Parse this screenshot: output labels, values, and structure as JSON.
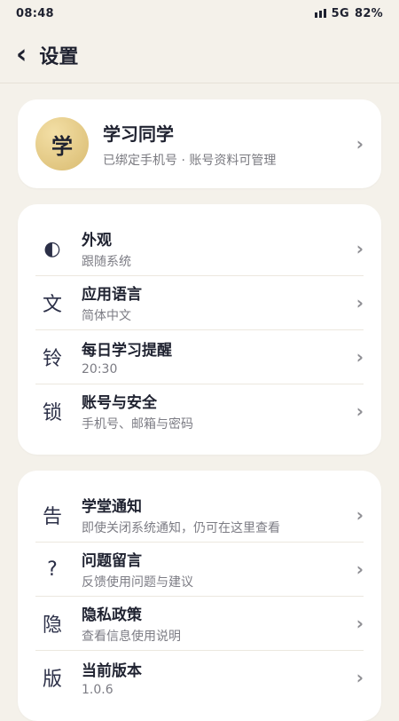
{
  "status": {
    "time": "08:48",
    "network": "5G",
    "battery": "82%"
  },
  "header": {
    "back_icon": "‹",
    "title": "设置"
  },
  "profile": {
    "avatar_text": "学",
    "name": "学习同学",
    "subtitle": "已绑定手机号 · 账号资料可管理",
    "chevron": "›"
  },
  "group1": [
    {
      "icon": "◐",
      "icon_name": "appearance-icon",
      "title": "外观",
      "subtitle": "跟随系统"
    },
    {
      "icon": "文",
      "icon_name": "language-icon",
      "title": "应用语言",
      "subtitle": "简体中文"
    },
    {
      "icon": "铃",
      "icon_name": "bell-icon",
      "title": "每日学习提醒",
      "subtitle": "20:30"
    },
    {
      "icon": "锁",
      "icon_name": "lock-icon",
      "title": "账号与安全",
      "subtitle": "手机号、邮箱与密码"
    }
  ],
  "group2": [
    {
      "icon": "告",
      "icon_name": "notice-icon",
      "title": "学堂通知",
      "subtitle": "即使关闭系统通知，仍可在这里查看"
    },
    {
      "icon": "?",
      "icon_name": "question-icon",
      "title": "问题留言",
      "subtitle": "反馈使用问题与建议"
    },
    {
      "icon": "隐",
      "icon_name": "privacy-icon",
      "title": "隐私政策",
      "subtitle": "查看信息使用说明"
    },
    {
      "icon": "版",
      "icon_name": "version-icon",
      "title": "当前版本",
      "subtitle": "1.0.6"
    }
  ],
  "chevron": "›"
}
